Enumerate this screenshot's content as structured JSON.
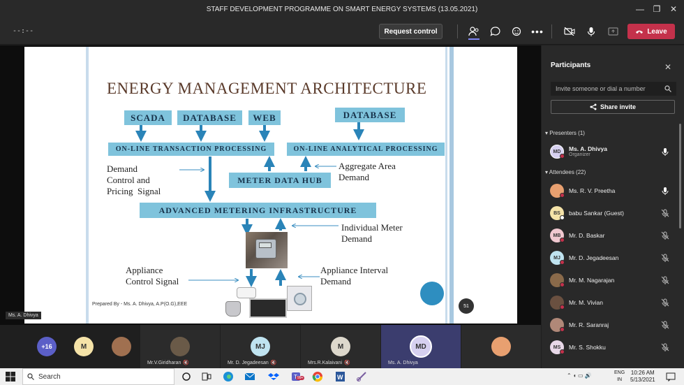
{
  "window": {
    "title": "STAFF DEVELOPMENT PROGRAMME ON SMART ENERGY SYSTEMS (13.05.2021)"
  },
  "toolbar": {
    "timer": "--:--",
    "request_control": "Request control",
    "leave": "Leave"
  },
  "slide": {
    "title": "ENERGY MANAGEMENT ARCHITECTURE",
    "boxes": {
      "scada": "SCADA",
      "database1": "DATABASE",
      "web": "WEB",
      "database2": "DATABASE",
      "oltp": "ON-LINE TRANSACTION PROCESSING",
      "olap": "ON-LINE ANALYTICAL PROCESSING",
      "mdh": "METER DATA HUB",
      "ami": "ADVANCED METERING INFRASTRUCTURE"
    },
    "labels": {
      "demand_control": "Demand\nControl and\nPricing  Signal",
      "aggregate": "Aggregate Area\nDemand",
      "individual": "Individual Meter\nDemand",
      "appliance_control": "Appliance\nControl Signal",
      "appliance_interval": "Appliance Interval\nDemand"
    },
    "prepared_by": "Prepared By - Ms. A. Dhivya, A.P(O.G),EEE",
    "page_number": "51",
    "presenter_tag": "Ms. A. Dhivya"
  },
  "participants": {
    "title": "Participants",
    "invite_placeholder": "Invite someone or dial a number",
    "share_invite": "Share invite",
    "presenters_header": "Presenters (1)",
    "attendees_header": "Attendees (22)",
    "presenters": [
      {
        "initials": "MD",
        "name": "Ms. A. Dhivya",
        "role": "Organizer",
        "color": "#d6d0f0"
      }
    ],
    "attendees": [
      {
        "initials": "",
        "name": "Ms. R. V. Preetha",
        "color": "#e8a070"
      },
      {
        "initials": "BS",
        "name": "babu Sankar (Guest)",
        "color": "#f5e3a8"
      },
      {
        "initials": "MB",
        "name": "Mr. D. Baskar",
        "color": "#f0c8d0"
      },
      {
        "initials": "MJ",
        "name": "Mr. D. Jegadeesan",
        "color": "#bfe3f0"
      },
      {
        "initials": "",
        "name": "Mr. M. Nagarajan",
        "color": "#8a6a4a"
      },
      {
        "initials": "",
        "name": "Mr. M. Vivian",
        "color": "#6a5040"
      },
      {
        "initials": "",
        "name": "Mr. R. Saranraj",
        "color": "#b08878"
      },
      {
        "initials": "MS",
        "name": "Mr. S. Shokku",
        "color": "#e8d8e8"
      }
    ]
  },
  "strip": {
    "overflow": "+16",
    "tiles": [
      {
        "initials": "M",
        "label": ""
      },
      {
        "initials": "",
        "label": ""
      },
      {
        "initials": "",
        "label": "Mr.V.Giridharan"
      },
      {
        "initials": "MJ",
        "label": "Mr. D. Jegadeesan"
      },
      {
        "initials": "M",
        "label": "Mrs.R.Kalaivani"
      },
      {
        "initials": "MD",
        "label": "Ms. A. Dhivya"
      },
      {
        "initials": "",
        "label": ""
      }
    ]
  },
  "taskbar": {
    "search": "Search",
    "lang1": "ENG",
    "lang2": "IN",
    "time": "10:26 AM",
    "date": "5/13/2021",
    "badge": "99+"
  }
}
